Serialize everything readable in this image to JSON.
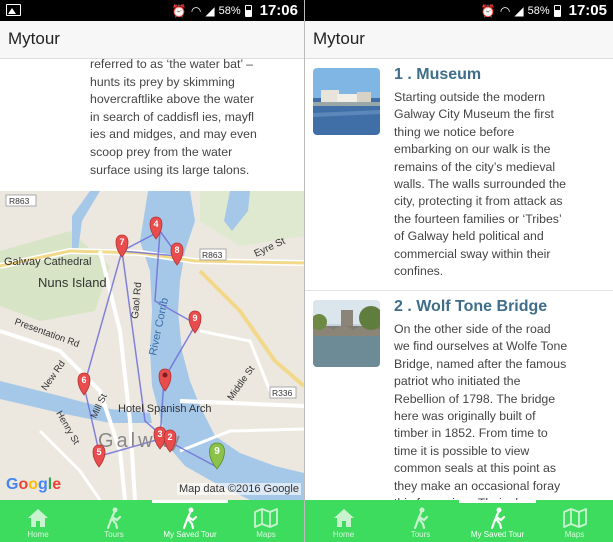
{
  "status_left": {
    "time": "17:06",
    "battery": "58%"
  },
  "status_right": {
    "time": "17:05",
    "battery": "58%"
  },
  "left": {
    "title": "Mytour",
    "description": "referred to as ‘the water bat’ –\nhunts its prey by skimming\nhovercraftlike above the water\nin search of caddisfl ies, mayfl\nies and midges, and may even\nscoop prey from the water\nsurface using its large talons.",
    "map": {
      "labels": {
        "r863a": "R863",
        "r863b": "R863",
        "r336": "R336",
        "cathedral": "Galway Cathedral",
        "nuns": "Nuns Island",
        "gaol": "Gaol Rd",
        "river": "River Corrib",
        "eyre": "Eyre St",
        "presentation": "Presentation Rd",
        "newrd": "New Rd",
        "mill": "Mill St",
        "henry": "Henry St",
        "middle": "Middle St",
        "hotel": "Hotel Spanish Arch",
        "galway": "Galway"
      },
      "markers": [
        "1",
        "2",
        "3",
        "4",
        "5",
        "6",
        "7",
        "8",
        "9",
        "S"
      ],
      "attribution": "Map data ©2016 Google",
      "google": "Google",
      "marker_color": "#e84c4c",
      "start_color": "#8bc34a"
    }
  },
  "right": {
    "title": "Mytour",
    "stops": [
      {
        "title": "1 . Museum",
        "text": "Starting outside the modern Galway City Museum the first thing we notice before embarking on our walk is the remains of the city’s medieval walls. The walls surrounded the city, protecting it from attack as the fourteen families or ‘Tribes’ of Galway held political and commercial sway within their confines."
      },
      {
        "title": "2 . Wolf Tone Bridge",
        "text": "On the other side of the road we find ourselves at Wolfe Tone Bridge, named after the famous patriot who initiated the Rebellion of 1798. The bridge here was originally built of timber in 1852. From time to time it is possible to view common seals at this point as they make an occasional foray this far upriver. Their close"
      }
    ]
  },
  "nav": [
    {
      "label": "Home",
      "icon": "home-icon"
    },
    {
      "label": "Tours",
      "icon": "walking-icon"
    },
    {
      "label": "My Saved Tour",
      "icon": "walking-icon"
    },
    {
      "label": "Maps",
      "icon": "map-icon"
    }
  ],
  "colors": {
    "nav_bg": "#3ddb5e",
    "title_blue": "#3e6e8a"
  }
}
